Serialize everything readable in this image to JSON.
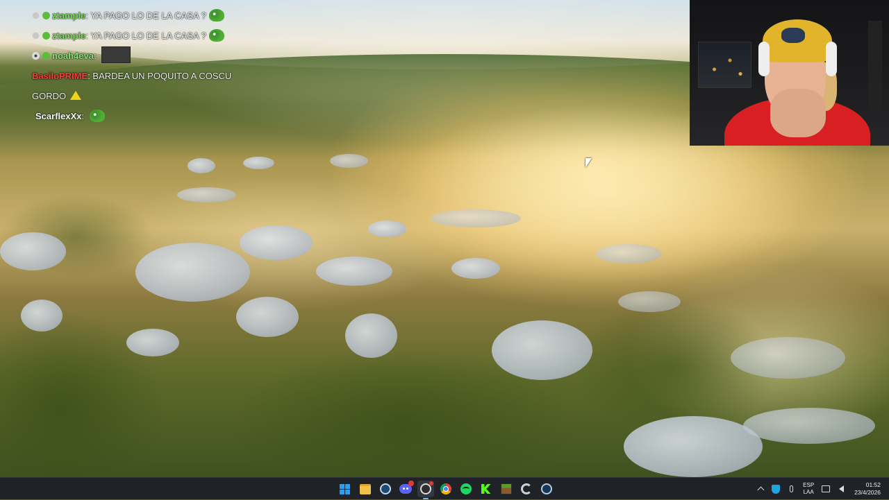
{
  "chat": {
    "messages": [
      {
        "username": "ztample",
        "text": "YA PAGO LO DE LA CASA ?",
        "user_color": "#7ddc5b",
        "emote": "frog"
      },
      {
        "username": "ztample",
        "text": "YA PAGO LO DE LA CASA ?",
        "user_color": "#7ddc5b",
        "emote": "frog"
      },
      {
        "username": "noah4eva",
        "text": "",
        "user_color": "#86e27a",
        "emote": "image"
      },
      {
        "username": "BasiloPRIME",
        "text": "BARDEA UN POQUITO A COSCU",
        "user_color": "#ff3b3b",
        "emote": ""
      },
      {
        "username": "",
        "text": "GORDO",
        "user_color": "#ffffff",
        "emote": "warning"
      },
      {
        "username": "ScarflexXx",
        "text": "",
        "user_color": "#ffffff",
        "emote": "frog"
      }
    ]
  },
  "taskbar": {
    "apps": [
      {
        "name": "start",
        "icon": "windows-start-icon",
        "active": false
      },
      {
        "name": "file-explorer",
        "icon": "folder-icon",
        "active": false
      },
      {
        "name": "steam",
        "icon": "steam-icon",
        "active": false
      },
      {
        "name": "discord",
        "icon": "discord-icon",
        "active": false
      },
      {
        "name": "obs",
        "icon": "obs-icon",
        "active": true
      },
      {
        "name": "chrome",
        "icon": "chrome-icon",
        "active": false
      },
      {
        "name": "spotify",
        "icon": "spotify-icon",
        "active": false
      },
      {
        "name": "kick",
        "icon": "kick-icon",
        "active": false
      },
      {
        "name": "minecraft",
        "icon": "minecraft-icon",
        "active": false
      },
      {
        "name": "ccleaner",
        "icon": "ccleaner-icon",
        "active": false
      },
      {
        "name": "steam-2",
        "icon": "steam-icon",
        "active": false
      }
    ],
    "tray": {
      "language_line1": "ESP",
      "language_line2": "LAA",
      "time": "01:52",
      "date": "23/4/2026"
    }
  },
  "colors": {
    "taskbar_bg": "#1f2327",
    "accent": "#7fb7f5"
  }
}
